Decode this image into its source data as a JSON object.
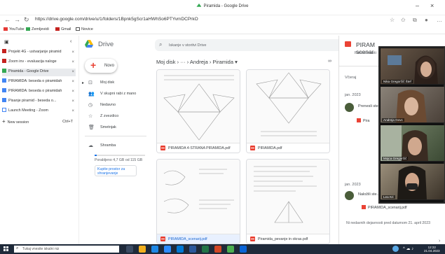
{
  "window": {
    "title": "Piramida - Google Drive",
    "min": "–",
    "close": "×"
  },
  "address": {
    "url": "https://drive.google.com/drive/u/1/folders/1Bpnk5gScr1aHWhSo6PTYvmDCPrkO"
  },
  "bookmarks": [
    "YouTube",
    "Zemljevidi",
    "Gmail",
    "Novice"
  ],
  "tabs": [
    {
      "label": "Projekt 4G - ustvarjanje piramid",
      "color": "#c5221f"
    },
    {
      "label": "Zoom inv - evaluacija naloge",
      "color": "#c5221f"
    },
    {
      "label": "Piramida - Google Drive",
      "color": "#34a853",
      "active": true
    },
    {
      "label": "PIRAMIDA: beseda o piramidah",
      "color": "#4285f4"
    },
    {
      "label": "PIRAMIDA: beseda o piramidah",
      "color": "#4285f4"
    },
    {
      "label": "Pisanje piramid - beseda o...",
      "color": "#4285f4"
    },
    {
      "label": "Launch Meeting - Zoom",
      "color": "#4285f4"
    }
  ],
  "new_tab": {
    "label": "New session",
    "shortcut": "Ctrl+T"
  },
  "drive": {
    "title": "Drive",
    "new_label": "Novo",
    "nav": [
      "Moj disk",
      "V skupni rabi z mano",
      "Nedavno",
      "Z zvezdico",
      "Smetnjak"
    ],
    "storage_label": "Shramba",
    "storage_text": "Porabljeno 4,7 GB od 115 GB",
    "storage_fraction": 0.04,
    "buy_label": "Kupite prostor za shranjevanje"
  },
  "search": {
    "placeholder": "Iskanje v storitvi Drive"
  },
  "breadcrumb": "Moj disk  ›  ···  ›  Andreja  ›  Piramida  ▾",
  "files": [
    {
      "name": "PIRAMIDA 4-STRANA PIRAMIDA.pdf",
      "selected": false
    },
    {
      "name": "PIRAMIDA.pdf",
      "selected": false
    },
    {
      "name": "PIRAMIDA_scenarij.pdf",
      "selected": true
    },
    {
      "name": "Piramida_pevanje in okras.pdf",
      "selected": false
    }
  ],
  "details": {
    "title_line1": "PIRAM",
    "title_line2": "scenar",
    "tab_details": "Podrobnosti",
    "tab_activity": "Dejavnost",
    "header": "Včeraj",
    "date1": "jan. 2023",
    "act1": "Prenesli ste...",
    "act1_file": "Pira",
    "date2": "jan. 2023",
    "act2": "Naložili ste...",
    "act2_file": "PIRAMIDA_scenarij.pdf",
    "footer": "Ni nedavnih dejavnosti pred datumom 21. april 2023"
  },
  "video": [
    {
      "name": "Nika Gregorčič Štef"
    },
    {
      "name": "Andreja Govc"
    },
    {
      "name": "Mojca Gregorčič"
    },
    {
      "name": "Lea Kri"
    }
  ],
  "taskbar": {
    "search_placeholder": "Tukaj vnesite iskalni niz",
    "time": "12:22",
    "date": "21.04.2023"
  }
}
